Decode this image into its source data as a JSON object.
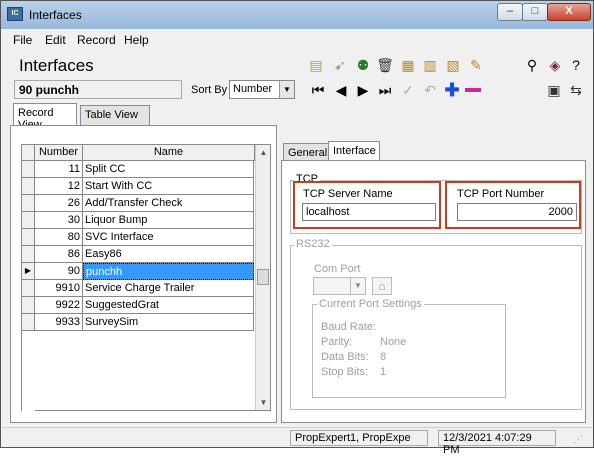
{
  "window": {
    "title": "Interfaces",
    "min_glyph": "–",
    "max_glyph": "□",
    "close_glyph": "X"
  },
  "menu": [
    "File",
    "Edit",
    "Record",
    "Help"
  ],
  "header": {
    "title": "Interfaces",
    "current_record": "90 punchh",
    "sort_label": "Sort By",
    "sort_value": "Number"
  },
  "tabs_left": [
    "Record View",
    "Table View"
  ],
  "grid": {
    "columns": [
      "Number",
      "Name"
    ],
    "rows": [
      {
        "number": "11",
        "name": "Split CC"
      },
      {
        "number": "12",
        "name": "Start With CC"
      },
      {
        "number": "26",
        "name": "Add/Transfer Check"
      },
      {
        "number": "30",
        "name": "Liquor Bump"
      },
      {
        "number": "80",
        "name": "SVC Interface"
      },
      {
        "number": "86",
        "name": "Easy86"
      },
      {
        "number": "90",
        "name": "punchh"
      },
      {
        "number": "9910",
        "name": "Service Charge Trailer"
      },
      {
        "number": "9922",
        "name": "SuggestedGrat"
      },
      {
        "number": "9933",
        "name": "SurveySim"
      }
    ],
    "selected_index": 6,
    "selected_marker": "▶"
  },
  "tabs_right": [
    "General",
    "Interface"
  ],
  "interface": {
    "tcp_group": "TCP",
    "server_label": "TCP Server Name",
    "server_value": "localhost",
    "port_label": "TCP Port Number",
    "port_value": "2000",
    "rs232_group": "RS232",
    "com_port_label": "Com Port",
    "port_settings_group": "Current Port Settings",
    "settings": [
      {
        "label": "Baud Rate:",
        "value": ""
      },
      {
        "label": "Parity:",
        "value": "None"
      },
      {
        "label": "Data Bits:",
        "value": "8"
      },
      {
        "label": "Stop Bits:",
        "value": "1"
      }
    ]
  },
  "status": {
    "user": "PropExpert1, PropExpe",
    "datetime": "12/3/2021 4:07:29 PM"
  },
  "colors": {
    "highlight": "#3399ff",
    "callout": "#cc3b1f"
  }
}
